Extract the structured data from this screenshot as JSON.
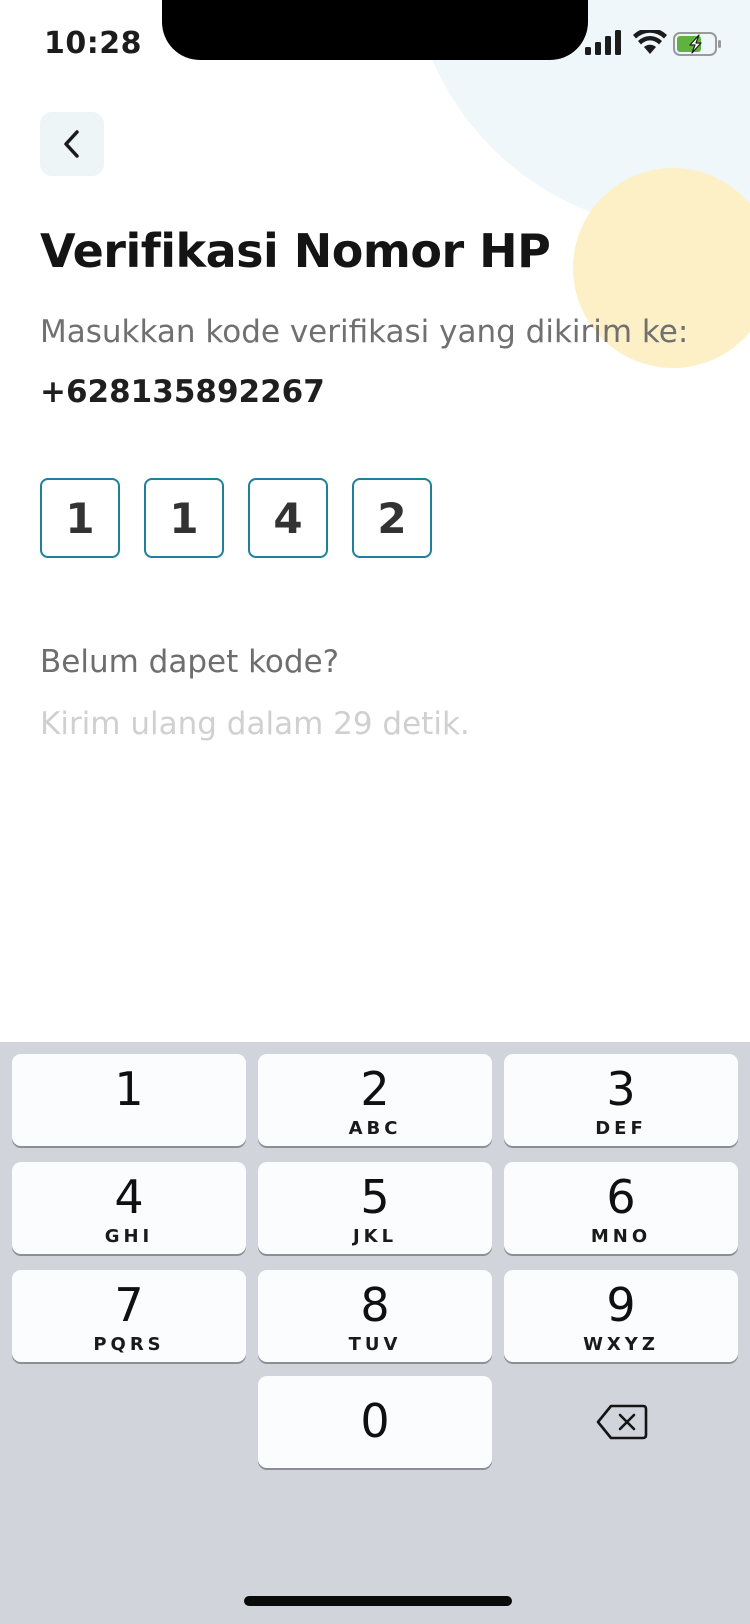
{
  "status_bar": {
    "time": "10:28",
    "icons": [
      "signal-icon",
      "wifi-icon",
      "battery-charging-icon"
    ]
  },
  "header": {
    "back_icon": "chevron-left-icon"
  },
  "main": {
    "title": "Verifikasi Nomor HP",
    "subtitle": "Masukkan kode verifikasi yang dikirim ke:",
    "phone_number": "+628135892267",
    "otp_digits": [
      "1",
      "1",
      "4",
      "2"
    ],
    "resend_question": "Belum dapet kode?",
    "resend_countdown": "Kirim ulang dalam 29 detik."
  },
  "keypad": {
    "keys": [
      {
        "digit": "1",
        "letters": ""
      },
      {
        "digit": "2",
        "letters": "ABC"
      },
      {
        "digit": "3",
        "letters": "DEF"
      },
      {
        "digit": "4",
        "letters": "GHI"
      },
      {
        "digit": "5",
        "letters": "JKL"
      },
      {
        "digit": "6",
        "letters": "MNO"
      },
      {
        "digit": "7",
        "letters": "PQRS"
      },
      {
        "digit": "8",
        "letters": "TUV"
      },
      {
        "digit": "9",
        "letters": "WXYZ"
      },
      {
        "digit": "0",
        "letters": ""
      }
    ],
    "delete_icon": "backspace-icon"
  },
  "colors": {
    "accent": "#1e7f9e",
    "deco_blue": "#eff7fa",
    "deco_yellow": "#fdf0c6",
    "keypad_bg": "#d1d4db"
  }
}
